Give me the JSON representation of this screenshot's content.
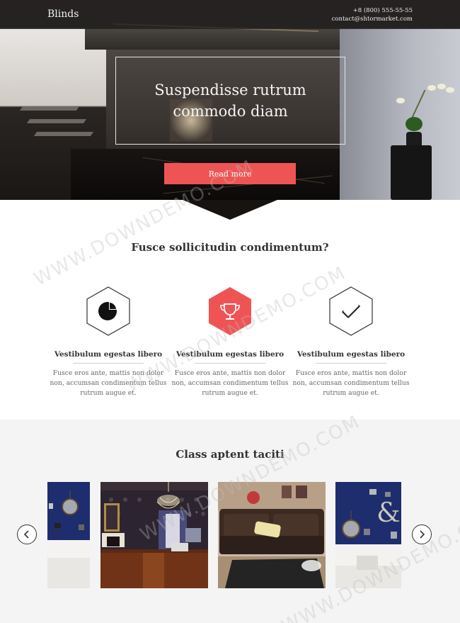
{
  "header": {
    "logo": "Blinds",
    "phone": "+8 (800) 555-55-55",
    "email": "contact@shtormarket.com"
  },
  "hero": {
    "title": "Suspendisse rutrum commodo diam",
    "cta_label": "Read more"
  },
  "features": {
    "title": "Fusce sollicitudin condimentum?",
    "items": [
      {
        "icon": "pie-chart-icon",
        "title": "Vestibulum egestas libero",
        "text": "Fusce eros ante, mattis non dolor non, accumsan condimentum tellus rutrum augue et.",
        "highlighted": false
      },
      {
        "icon": "trophy-icon",
        "title": "Vestibulum egestas libero",
        "text": "Fusce eros ante, mattis non dolor non, accumsan condimentum tellus rutrum augue et.",
        "highlighted": true
      },
      {
        "icon": "checkmark-icon",
        "title": "Vestibulum egestas libero",
        "text": "Fusce eros ante, mattis non dolor non, accumsan condimentum tellus rutrum augue et.",
        "highlighted": false
      }
    ]
  },
  "gallery": {
    "title": "Class aptent taciti",
    "items": [
      {
        "name": "blue-wall-living-room-photo"
      },
      {
        "name": "classic-hall-chandelier-photo"
      },
      {
        "name": "leather-sofa-room-photo"
      },
      {
        "name": "blue-wall-mirror-photo"
      }
    ]
  },
  "watermark": "WWW.DOWNDEMO.COM",
  "colors": {
    "accent": "#ef5454",
    "topbar": "#232120",
    "text_dark": "#333333",
    "gallery_bg": "#f4f4f4"
  }
}
